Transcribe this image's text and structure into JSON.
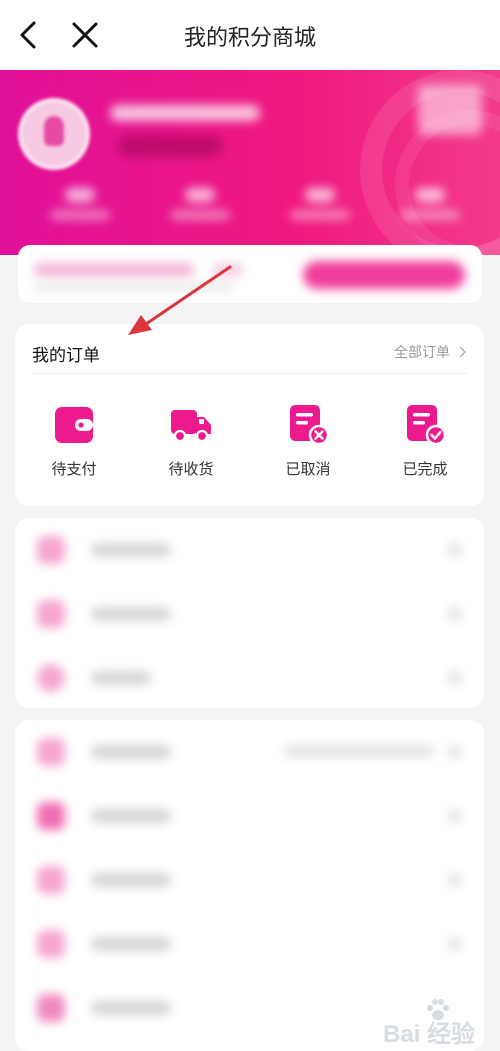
{
  "nav": {
    "title": "我的积分商城"
  },
  "orders": {
    "heading": "我的订单",
    "view_all": "全部订单",
    "items": [
      {
        "label": "待支付",
        "icon": "wallet-icon"
      },
      {
        "label": "待收货",
        "icon": "truck-icon"
      },
      {
        "label": "已取消",
        "icon": "order-cancel-icon"
      },
      {
        "label": "已完成",
        "icon": "order-done-icon"
      }
    ]
  },
  "watermark": {
    "text": "Bai 经验"
  },
  "colors": {
    "accent": "#ec1a8c",
    "hero": "#e0109a",
    "annotation": "#d9363e"
  }
}
